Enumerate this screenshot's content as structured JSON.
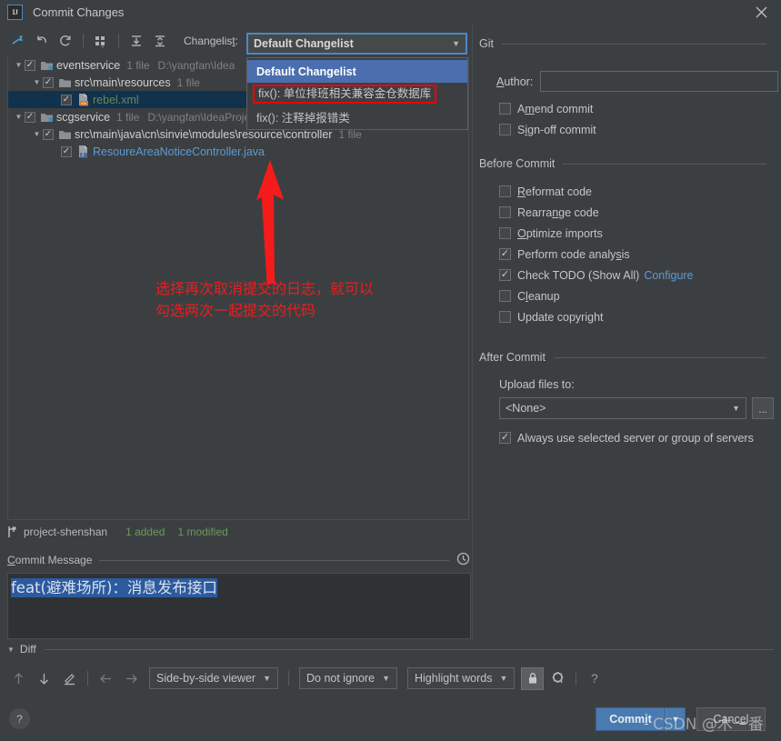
{
  "window": {
    "title": "Commit Changes",
    "logo_text": "IJ",
    "close_icon": "close-icon"
  },
  "toolbar": {
    "icons": [
      {
        "name": "move-to-changelist-icon",
        "glyph": "⤴"
      },
      {
        "name": "rollback-icon",
        "glyph": "↶"
      },
      {
        "name": "refresh-icon",
        "glyph": "⟳"
      },
      {
        "name": "group-by-icon",
        "glyph": "∷"
      },
      {
        "name": "expand-all-icon",
        "glyph": "⤓"
      },
      {
        "name": "collapse-all-icon",
        "glyph": "⤒"
      }
    ],
    "changelist_label": "Changelist:",
    "changelist_mnemonic": "t"
  },
  "changelist_combo": {
    "selected": "Default Changelist",
    "open": true,
    "options": [
      {
        "label": "Default Changelist",
        "selected": true,
        "highlighted": false
      },
      {
        "label": "fix(): 单位排班相关兼容金仓数据库",
        "selected": false,
        "highlighted": true
      },
      {
        "label": "fix(): 注释掉报错类",
        "selected": false,
        "highlighted": false
      }
    ],
    "highlight_border_color": "#f00000"
  },
  "file_tree": {
    "rows": [
      {
        "indent": 0,
        "twisty": "▼",
        "checked": true,
        "icon": "module-folder-icon",
        "name": "eventservice",
        "name_class": "nm-module",
        "count": "1 file",
        "path": "D:\\yangfan\\Idea",
        "selected": false
      },
      {
        "indent": 1,
        "twisty": "▼",
        "checked": true,
        "icon": "folder-icon",
        "name": "src\\main\\resources",
        "name_class": "nm-dir",
        "count": "1 file",
        "path": "",
        "selected": false
      },
      {
        "indent": 2,
        "twisty": "",
        "checked": true,
        "icon": "xml-file-icon",
        "name": "rebel.xml",
        "name_class": "nm-xml",
        "count": "",
        "path": "",
        "selected": true
      },
      {
        "indent": 0,
        "twisty": "▼",
        "checked": true,
        "icon": "module-folder-icon",
        "name": "scgservice",
        "name_class": "nm-module",
        "count": "1 file",
        "path": "D:\\yangfan\\IdeaProjects\\sinvie\\SIOC-SERVER\\scgservice",
        "selected": false
      },
      {
        "indent": 1,
        "twisty": "▼",
        "checked": true,
        "icon": "folder-icon",
        "name": "src\\main\\java\\cn\\sinvie\\modules\\resource\\controller",
        "name_class": "nm-dir",
        "count": "1 file",
        "path": "",
        "selected": false
      },
      {
        "indent": 2,
        "twisty": "",
        "checked": true,
        "icon": "java-file-icon",
        "name": "ResoureAreaNoticeController.java",
        "name_class": "nm-java",
        "count": "",
        "path": "",
        "selected": false
      }
    ]
  },
  "annotation": {
    "line1": "选择再次取消提交的日志，就可以",
    "line2": "勾选两次一起提交的代码",
    "color": "#ee1c1c"
  },
  "status_line": {
    "branch_icon": "branch-icon",
    "project": "project-shenshan",
    "added": "1 added",
    "modified": "1 modified",
    "stat_color": "#6a9b5e"
  },
  "commit_message": {
    "section_label": "Commit Message",
    "mnemonic": "C",
    "history_icon": "clock-history-icon",
    "value": "feat(避难场所)：消息发布接口",
    "placeholder": "",
    "selection_color": "#2d5a9e"
  },
  "git_panel": {
    "section_label": "Git",
    "author_label": "Author:",
    "author_mnemonic": "A",
    "author_value": "",
    "author_placeholder": "",
    "checkboxes": [
      {
        "label": "Amend commit",
        "mnemonic": "m",
        "checked": false
      },
      {
        "label": "Sign-off commit",
        "mnemonic": "i",
        "checked": false
      }
    ]
  },
  "before_commit": {
    "section_label": "Before Commit",
    "checkboxes": [
      {
        "label": "Reformat code",
        "mnemonic": "R",
        "checked": false,
        "link": ""
      },
      {
        "label": "Rearrange code",
        "mnemonic": "n",
        "checked": false,
        "link": ""
      },
      {
        "label": "Optimize imports",
        "mnemonic": "O",
        "checked": false,
        "link": ""
      },
      {
        "label": "Perform code analysis",
        "mnemonic": "s",
        "checked": true,
        "link": ""
      },
      {
        "label": "Check TODO (Show All)",
        "mnemonic": "",
        "checked": true,
        "link": "Configure"
      },
      {
        "label": "Cleanup",
        "mnemonic": "l",
        "checked": false,
        "link": ""
      },
      {
        "label": "Update copyright",
        "mnemonic": "",
        "checked": false,
        "link": ""
      }
    ],
    "link_color": "#5b9bd5"
  },
  "after_commit": {
    "section_label": "After Commit",
    "upload_label": "Upload files to:",
    "upload_value": "<None>",
    "browse_label": "...",
    "always_use_label": "Always use selected server or group of servers",
    "always_use_checked": true
  },
  "diff": {
    "section_label": "Diff",
    "twisty": "▼",
    "buttons": [
      {
        "name": "previous-difference-icon",
        "glyph": "↑",
        "state": "dim"
      },
      {
        "name": "next-difference-icon",
        "glyph": "↓",
        "state": "normal"
      },
      {
        "name": "edit-source-icon",
        "glyph": "✎",
        "state": "normal"
      },
      {
        "name": "accept-left-icon",
        "glyph": "←",
        "state": "dim"
      },
      {
        "name": "accept-right-icon",
        "glyph": "→",
        "state": "dim"
      }
    ],
    "viewer_mode": "Side-by-side viewer",
    "ignore_mode": "Do not ignore",
    "highlight_mode": "Highlight words",
    "lock_icon": "lock-icon",
    "settings_icon": "gear-icon",
    "help_icon": "help-icon",
    "help_glyph": "?"
  },
  "footer": {
    "help_glyph": "?",
    "commit_label": "Commit",
    "commit_mnemonic": "i",
    "commit_dropdown_glyph": "▼",
    "cancel_label": "Cancel",
    "cancel_mnemonic": "e",
    "commit_color": "#4a7ab0"
  },
  "watermark": {
    "text": "CSDN @木一番"
  }
}
